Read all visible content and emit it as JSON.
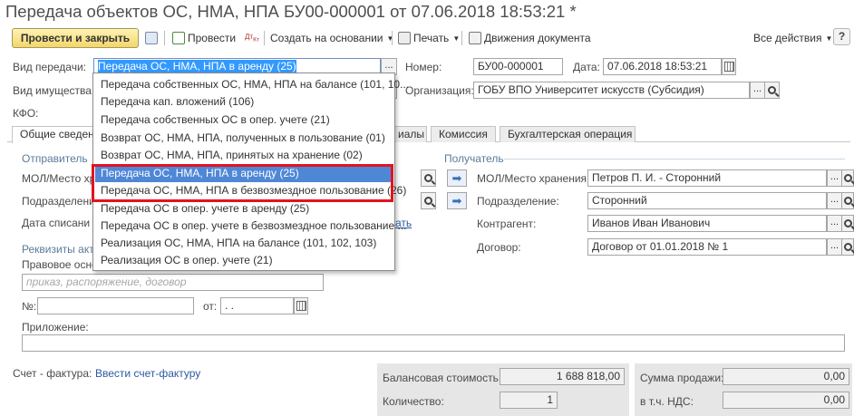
{
  "window": {
    "title": "Передача объектов ОС, НМА, НПА БУ00-000001 от 07.06.2018 18:53:21 *"
  },
  "toolbar": {
    "post_close": "Провести и закрыть",
    "post": "Провести",
    "create_based": "Создать на основании",
    "print": "Печать",
    "movements": "Движения документа",
    "all_actions": "Все действия",
    "help": "?"
  },
  "header": {
    "transfer_type_label": "Вид передачи:",
    "transfer_type_value": "Передача ОС, НМА, НПА в аренду (25)",
    "number_label": "Номер:",
    "number_value": "БУ00-000001",
    "date_label": "Дата:",
    "date_value": "07.06.2018 18:53:21",
    "property_type_label": "Вид имущества:",
    "organization_label": "Организация:",
    "organization_value": "ГОБУ ВПО Университет искусств (Субсидия)",
    "kfo_label": "КФО:"
  },
  "tabs": [
    {
      "label": "Общие сведени"
    },
    {
      "label": "иалы"
    },
    {
      "label": "Комиссия"
    },
    {
      "label": "Бухгалтерская операция"
    }
  ],
  "sender": {
    "group": "Отправитель",
    "mol_label": "МОЛ/Место хр",
    "dept_label": "Подразделени",
    "writeoff_label": "Дата списани",
    "writeoff_link": "ать"
  },
  "receiver": {
    "group": "Получатель",
    "mol_label": "МОЛ/Место хранения:",
    "mol_value": "Петров П. И. - Сторонний",
    "dept_label": "Подразделение:",
    "dept_value": "Сторонний",
    "contractor_label": "Контрагент:",
    "contractor_value": "Иванов Иван Иванович",
    "contract_label": "Договор:",
    "contract_value": "Договор от 01.01.2018 № 1"
  },
  "requisites": {
    "group": "Реквизиты акт",
    "legal_basis_label": "Правовое осно",
    "legal_basis_placeholder": "приказ, распоряжение, договор",
    "number_label": "№:",
    "from_label": "от:",
    "date_placeholder": " .  .",
    "attachment_label": "Приложение:"
  },
  "dropdown": {
    "items": [
      "Передача собственных ОС, НМА, НПА на балансе (101, 10...",
      "Передача кап. вложений (106)",
      "Передача собственных ОС в опер. учете (21)",
      "Возврат ОС, НМА, НПА, полученных в пользование (01)",
      "Возврат ОС, НМА, НПА, принятых на хранение (02)",
      "Передача ОС, НМА, НПА в аренду (25)",
      "Передача ОС, НМА, НПА в безвозмездное пользование (26)",
      "Передача ОС в опер. учете в аренду (25)",
      "Передача ОС в опер. учете в безвозмездное пользование ...",
      "Реализация ОС, НМА, НПА на балансе (101, 102, 103)",
      "Реализация ОС в опер. учете (21)"
    ],
    "selected_index": 5
  },
  "footer": {
    "invoice_label": "Счет - фактура:",
    "invoice_link": "Ввести счет-фактуру",
    "balance_label": "Балансовая стоимость:",
    "balance_value": "1 688 818,00",
    "quantity_label": "Количество:",
    "quantity_value": "1",
    "sale_sum_label": "Сумма продажи:",
    "sale_sum_value": "0,00",
    "vat_label": "в т.ч. НДС:",
    "vat_value": "0,00"
  },
  "colors": {
    "highlight": "#4f87d7",
    "red_frame": "#e1141e",
    "primary_button": "#f3d66b"
  }
}
